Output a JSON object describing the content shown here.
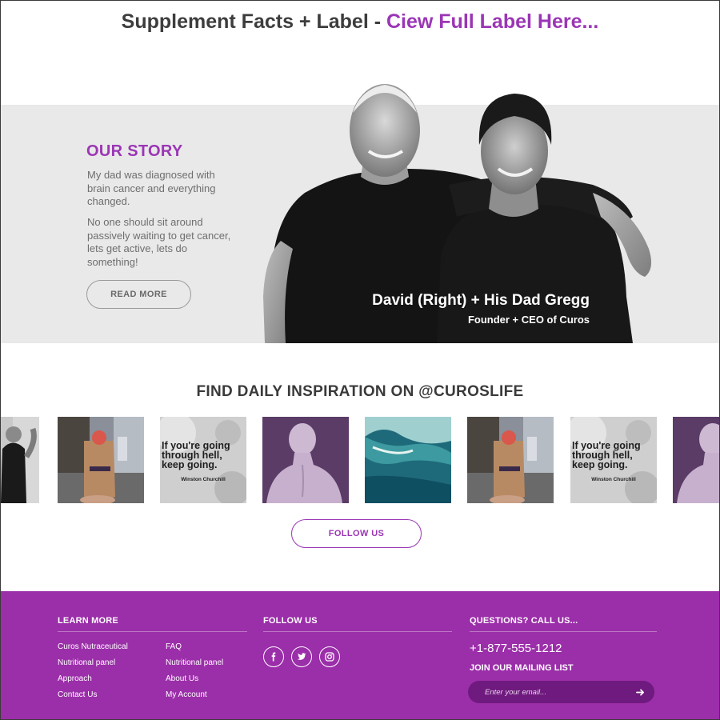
{
  "header": {
    "label_text": "Supplement Facts + Label - ",
    "link_text": "Ciew Full Label Here..."
  },
  "story": {
    "title": "OUR STORY",
    "paragraph1": "My dad was diagnosed with brain cancer and everything changed.",
    "paragraph2": "No one should sit around passively waiting to get cancer, lets get active, lets do something!",
    "read_more_label": "READ MORE",
    "caption_title": "David (Right) + His Dad Gregg",
    "caption_subtitle": "Founder + CEO of Curos"
  },
  "instagram": {
    "heading": "FIND DAILY INSPIRATION ON @CUROSLIFE",
    "quote_text": "If you're going through hell, keep going.",
    "quote_author": "Winston Churchill",
    "follow_label": "FOLLOW US"
  },
  "footer": {
    "learn_more": {
      "heading": "LEARN MORE",
      "col1": [
        "Curos Nutraceutical",
        "Nutritional panel",
        "Approach",
        "Contact Us"
      ],
      "col2": [
        "FAQ",
        "Nutritional panel",
        "About Us",
        "My Account"
      ]
    },
    "follow": {
      "heading": "FOLLOW US",
      "icons": [
        "facebook-icon",
        "twitter-icon",
        "instagram-icon"
      ]
    },
    "contact": {
      "heading": "QUESTIONS? CALL US...",
      "phone": "+1-877-555-1212",
      "mailing_heading": "JOIN OUR MAILING LIST",
      "email_placeholder": "Enter your email..."
    }
  },
  "colors": {
    "accent": "#9b36b5",
    "footer_bg": "#9b2ea9",
    "band_bg": "#e9e9e9"
  }
}
